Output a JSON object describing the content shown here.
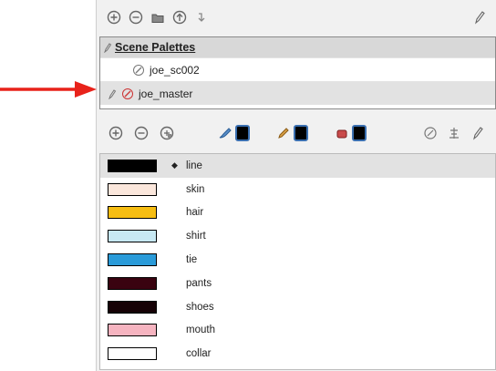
{
  "palette_toolbar": {
    "icons": [
      "add-palette-icon",
      "remove-palette-icon",
      "folder-icon",
      "import-icon",
      "export-icon",
      "pencil-icon"
    ]
  },
  "palette_list": {
    "header": "Scene Palettes",
    "items": [
      {
        "label": "joe_sc002",
        "icon": "lock-icon",
        "selected": false
      },
      {
        "label": "joe_master",
        "icon": "edit-palette-icon",
        "selected": true
      }
    ]
  },
  "colors_toolbar": {
    "icons": [
      "add-color-icon",
      "remove-color-icon",
      "add-texture-icon",
      "brush-color-icon",
      "paint-color-icon",
      "paint-bucket-color-icon",
      "eyedropper-icon",
      "scale-icon",
      "edit-color-icon"
    ]
  },
  "swatches": [
    {
      "label": "line",
      "color": "#000000",
      "selected": true
    },
    {
      "label": "skin",
      "color": "#fbe7dc",
      "selected": false
    },
    {
      "label": "hair",
      "color": "#f6bd12",
      "selected": false
    },
    {
      "label": "shirt",
      "color": "#c7e8f3",
      "selected": false
    },
    {
      "label": "tie",
      "color": "#2a9bd9",
      "selected": false
    },
    {
      "label": "pants",
      "color": "#3a0310",
      "selected": false
    },
    {
      "label": "shoes",
      "color": "#160206",
      "selected": false
    },
    {
      "label": "mouth",
      "color": "#f6b4c0",
      "selected": false
    },
    {
      "label": "collar",
      "color": "#ffffff",
      "selected": false
    }
  ],
  "annotation": {
    "arrow_color": "#e8221a"
  }
}
